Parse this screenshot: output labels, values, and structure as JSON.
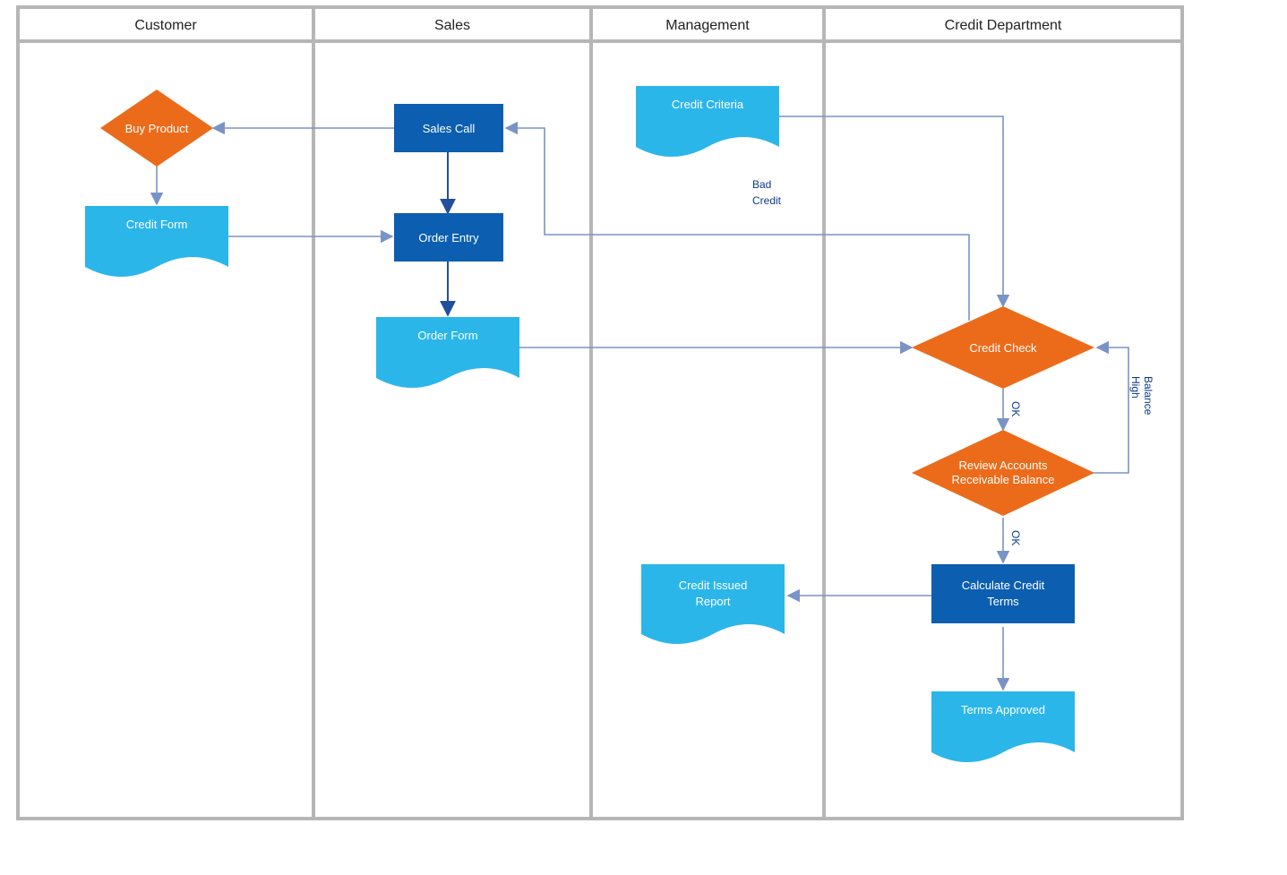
{
  "lanes": {
    "customer": "Customer",
    "sales": "Sales",
    "management": "Management",
    "credit_dept": "Credit Department"
  },
  "nodes": {
    "buy_product": "Buy Product",
    "credit_form": "Credit Form",
    "sales_call": "Sales Call",
    "order_entry": "Order Entry",
    "order_form": "Order Form",
    "credit_criteria": "Credit Criteria",
    "credit_check": "Credit Check",
    "review_accounts_l1": "Review Accounts",
    "review_accounts_l2": "Receivable Balance",
    "calculate_terms_l1": "Calculate Credit",
    "calculate_terms_l2": "Terms",
    "credit_issued_l1": "Credit Issued",
    "credit_issued_l2": "Report",
    "terms_approved": "Terms Approved"
  },
  "edge_labels": {
    "bad_credit_l1": "Bad",
    "bad_credit_l2": "Credit",
    "ok1": "OK",
    "ok2": "OK",
    "high_balance_l1": "High",
    "high_balance_l2": "Balance"
  },
  "colors": {
    "orange": "#ec6b1a",
    "blue_dark": "#0c5eb0",
    "blue_light": "#2bb6ea",
    "arrow": "#7a93c7",
    "arrow_dark": "#224f9c",
    "lane_border": "#b6b6b6"
  }
}
